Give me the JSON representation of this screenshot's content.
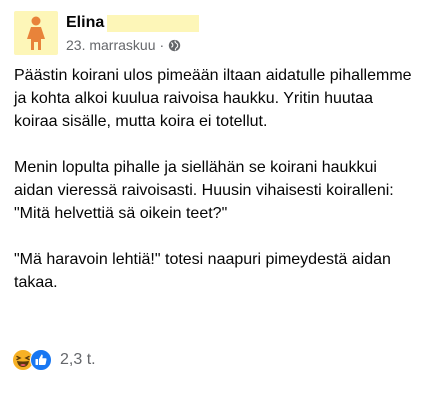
{
  "post": {
    "author": "Elina",
    "date": "23. marraskuu",
    "separator": "·",
    "privacy_icon": "globe-icon",
    "paragraphs": [
      "Päästin koirani ulos pimeään iltaan aidatulle pihallemme ja kohta alkoi kuulua raivoisa haukku. Yritin huutaa koiraa sisälle, mutta koira ei totellut.",
      "Menin lopulta pihalle ja siellähän se koirani haukkui aidan vieressä raivoisasti. Huusin vihaisesti koiralleni: \"Mitä helvettiä sä oikein teet?\"",
      "\"Mä haravoin lehtiä!\" totesi naapuri pimeydestä aidan takaa."
    ]
  },
  "reactions": {
    "icons": [
      "laugh-reaction-icon",
      "like-reaction-icon"
    ],
    "count": "2,3 t."
  },
  "colors": {
    "redaction": "#fdf6b8",
    "avatar_figure": "#e8833a",
    "like_blue": "#1877f2",
    "haha_yellow": "#f7b125",
    "meta_gray": "#65676b"
  }
}
